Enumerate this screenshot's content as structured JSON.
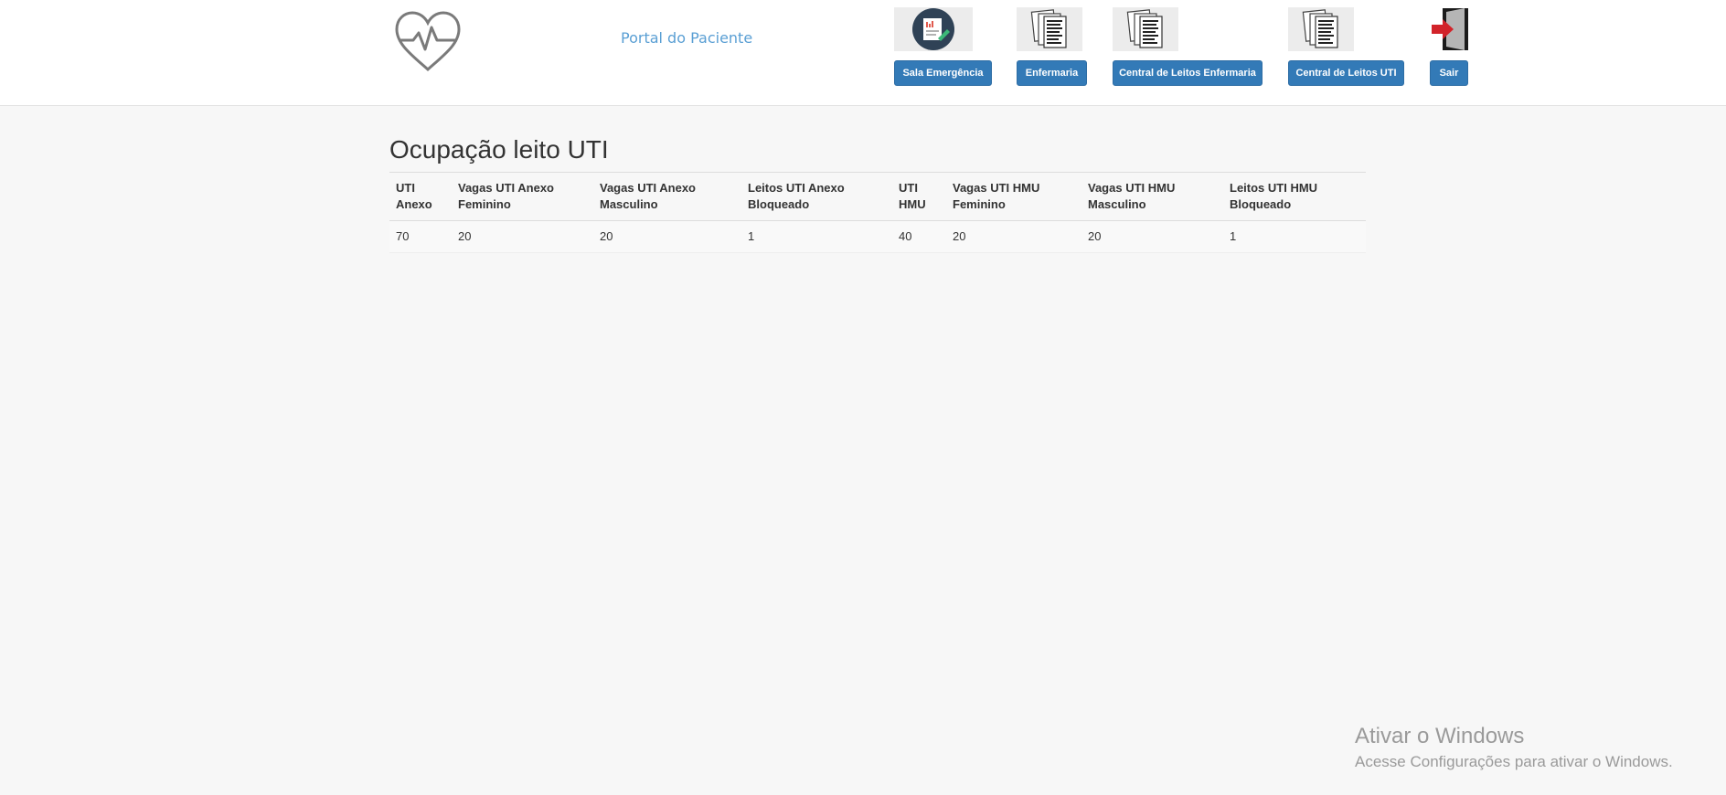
{
  "header": {
    "portal_title": "Portal do Paciente",
    "nav": [
      {
        "label": "Sala Emergência",
        "icon": "emergency-report-icon"
      },
      {
        "label": "Enfermaria",
        "icon": "documents-icon"
      },
      {
        "label": "Central de Leitos Enfermaria",
        "icon": "documents-icon"
      },
      {
        "label": "Central de Leitos UTI",
        "icon": "documents-icon"
      },
      {
        "label": "Sair",
        "icon": "exit-door-icon"
      }
    ]
  },
  "main": {
    "title": "Ocupação leito UTI",
    "table": {
      "headers": [
        "UTI Anexo",
        "Vagas UTI Anexo Feminino",
        "Vagas UTI Anexo Masculino",
        "Leitos UTI Anexo Bloqueado",
        "UTI HMU",
        "Vagas UTI HMU Feminino",
        "Vagas UTI HMU Masculino",
        "Leitos UTI HMU Bloqueado"
      ],
      "rows": [
        [
          "70",
          "20",
          "20",
          "1",
          "40",
          "20",
          "20",
          "1"
        ]
      ]
    }
  },
  "watermark": {
    "title": "Ativar o Windows",
    "subtitle": "Acesse Configurações para ativar o Windows."
  },
  "colors": {
    "button_bg": "#337ab7",
    "portal_title": "#5a9fd4",
    "page_bg": "#f7f7f7"
  }
}
